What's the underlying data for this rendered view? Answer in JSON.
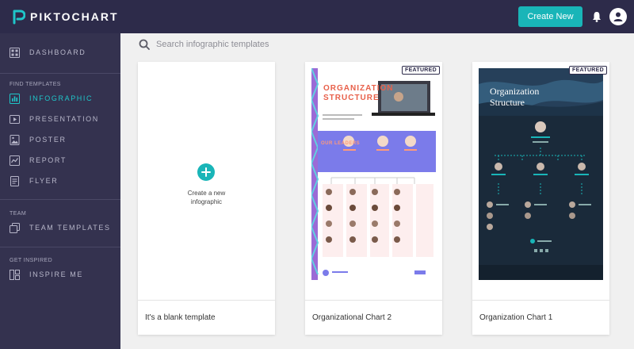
{
  "app": {
    "logo_text": "PIKTOCHART"
  },
  "header": {
    "create_button": "Create New"
  },
  "sidebar": {
    "dashboard": "DASHBOARD",
    "find_templates_label": "FIND TEMPLATES",
    "items": [
      {
        "label": "INFOGRAPHIC",
        "icon": "bar-chart-icon"
      },
      {
        "label": "PRESENTATION",
        "icon": "presentation-icon"
      },
      {
        "label": "POSTER",
        "icon": "image-icon"
      },
      {
        "label": "REPORT",
        "icon": "line-chart-icon"
      },
      {
        "label": "FLYER",
        "icon": "document-icon"
      }
    ],
    "team_label": "TEAM",
    "team_templates": "TEAM TEMPLATES",
    "get_inspired_label": "GET INSPIRED",
    "inspire_me": "INSPIRE ME"
  },
  "search": {
    "placeholder": "Search infographic templates"
  },
  "cards": [
    {
      "name": "It's a blank template",
      "create_line1": "Create a new",
      "create_line2": "infographic"
    },
    {
      "name": "Organizational Chart 2",
      "badge": "FEATURED",
      "thumb_title_1": "ORGANIZATION",
      "thumb_title_2": "STRUCTURE",
      "thumb_section": "OUR LEADERS"
    },
    {
      "name": "Organization Chart 1",
      "badge": "FEATURED",
      "thumb_title_1": "Organization",
      "thumb_title_2": "Structure"
    }
  ],
  "colors": {
    "accent": "#19b5b8",
    "sidebar": "#34324f",
    "topbar": "#2d2b4a"
  }
}
